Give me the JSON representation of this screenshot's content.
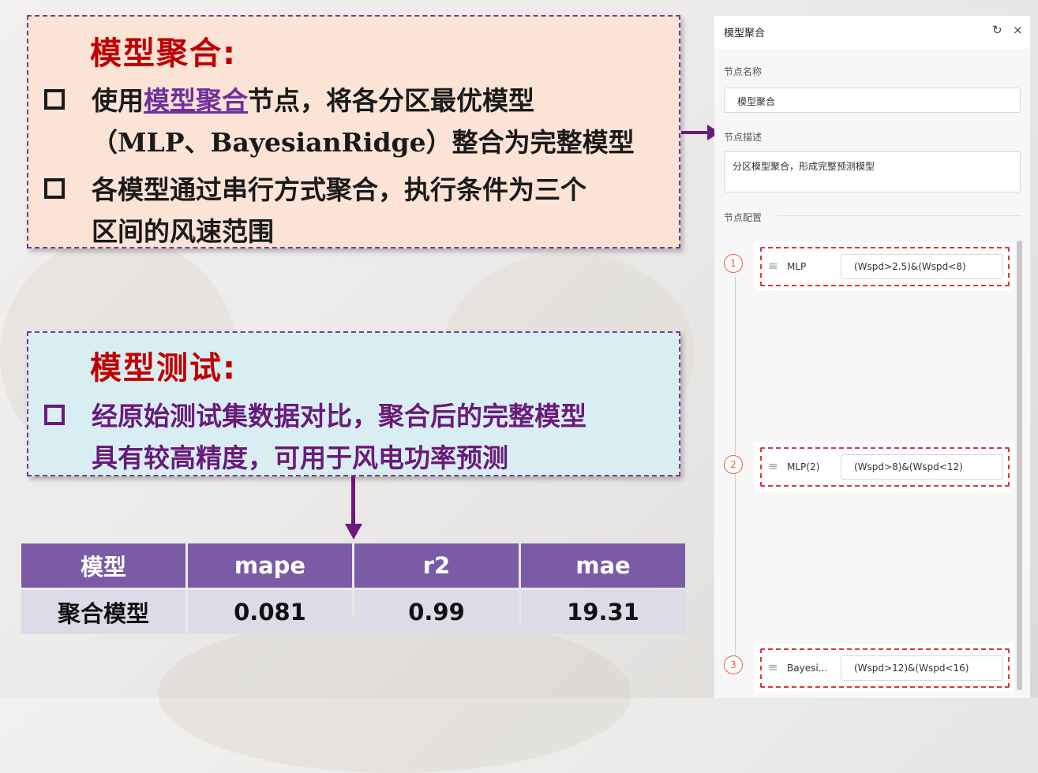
{
  "section1": {
    "title": "模型聚合:",
    "bullet1_pre": "使用",
    "bullet1_link": "模型聚合",
    "bullet1_post": "节点，将各分区最优模型",
    "bullet1_line2_open": "（",
    "bullet1_line2_models": "MLP、BayesianRidge",
    "bullet1_line2_close": "）整合为完整模型",
    "bullet2_line1": "各模型通过串行方式聚合，执行条件为三个",
    "bullet2_line2": "区间的风速范围"
  },
  "section2": {
    "title": "模型测试:",
    "bullet1_line1": "经原始测试集数据对比，聚合后的完整模型",
    "bullet1_line2": "具有较高精度，可用于风电功率预测"
  },
  "table": {
    "headers": [
      "模型",
      "mape",
      "r2",
      "mae"
    ],
    "row": [
      "聚合模型",
      "0.081",
      "0.99",
      "19.31"
    ]
  },
  "panel": {
    "title": "模型聚合",
    "refresh_icon": "refresh-icon",
    "close_icon": "close-icon",
    "name_label": "节点名称",
    "name_value": "模型聚合",
    "desc_label": "节点描述",
    "desc_value": "分区模型聚合，形成完整预测模型",
    "config_label": "节点配置",
    "steps": [
      {
        "num": "1",
        "model": "MLP",
        "condition": "(Wspd>2.5)&(Wspd<8)"
      },
      {
        "num": "2",
        "model": "MLP(2)",
        "condition": "(Wspd>8)&(Wspd<12)"
      },
      {
        "num": "3",
        "model": "Bayesi...",
        "condition": "(Wspd>12)&(Wspd<16)"
      }
    ]
  },
  "colors": {
    "accent_red": "#c00000",
    "purple": "#7030a0",
    "table_header": "#7b5aa6",
    "step_orange": "#e8623d"
  }
}
